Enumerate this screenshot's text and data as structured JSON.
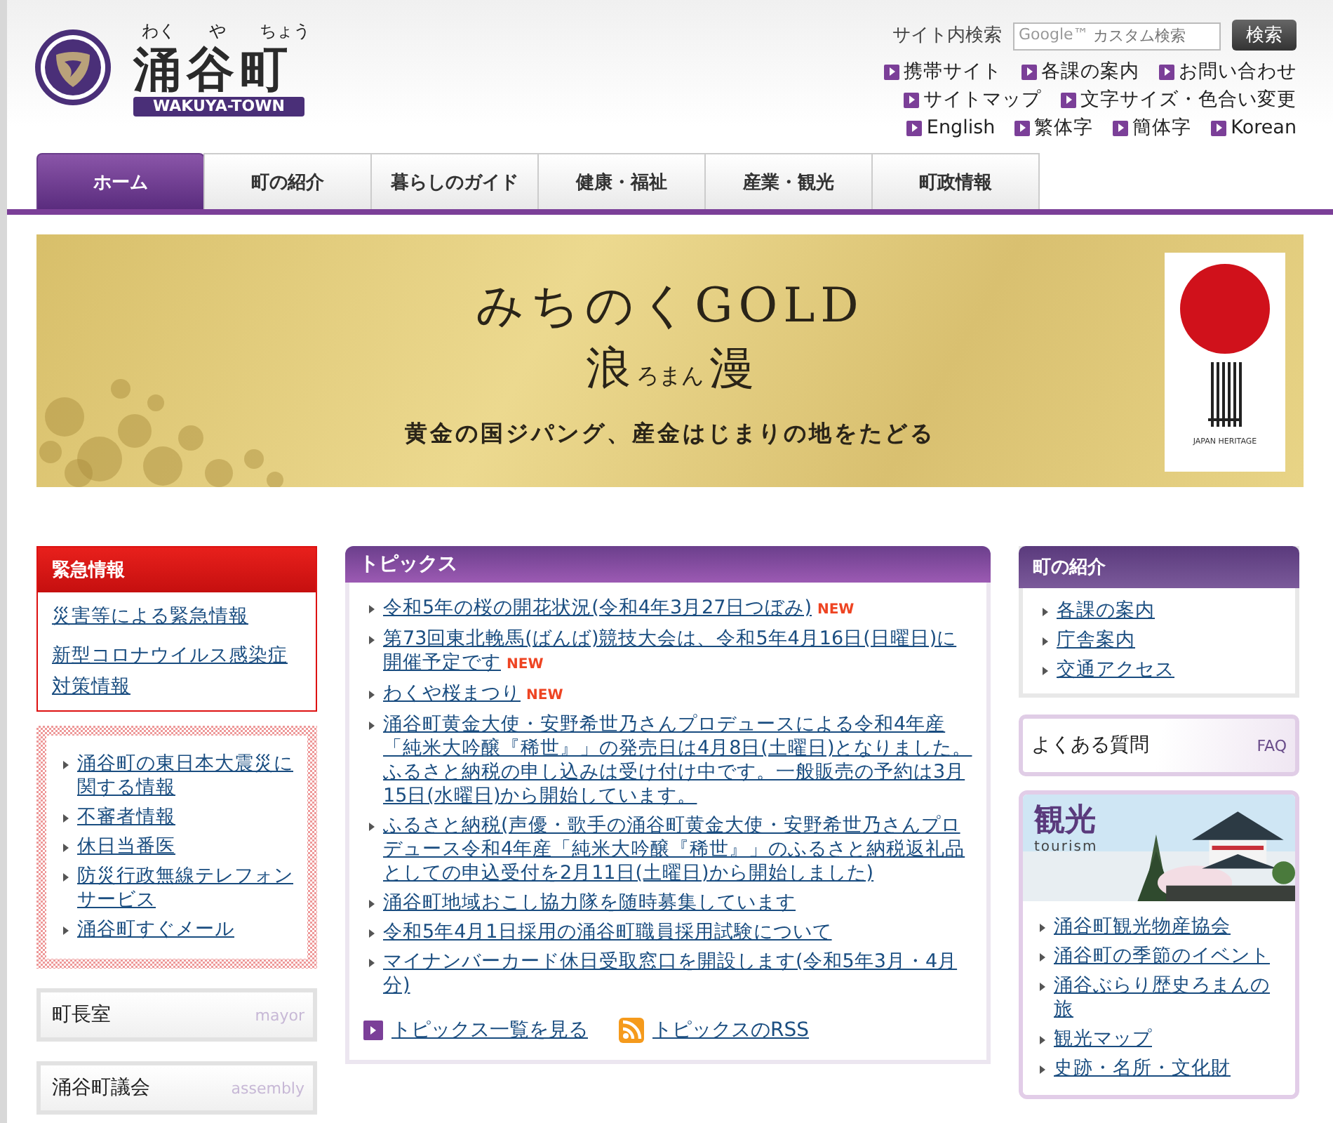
{
  "header": {
    "ruby": [
      "わく",
      "や",
      "ちょう"
    ],
    "title": "涌谷町",
    "subtitle": "WAKUYA-TOWN",
    "search": {
      "label": "サイト内検索",
      "brand": "Google™",
      "placeholder": "カスタム検索",
      "button": "検索"
    },
    "utility_links": [
      [
        "携帯サイト",
        "各課の案内",
        "お問い合わせ"
      ],
      [
        "サイトマップ",
        "文字サイズ・色合い変更"
      ],
      [
        "English",
        "繁体字",
        "簡体字",
        "Korean"
      ]
    ]
  },
  "tabs": [
    {
      "label": "ホーム",
      "selected": true
    },
    {
      "label": "町の紹介",
      "selected": false
    },
    {
      "label": "暮らしのガイド",
      "selected": false
    },
    {
      "label": "健康・福祉",
      "selected": false
    },
    {
      "label": "産業・観光",
      "selected": false
    },
    {
      "label": "町政情報",
      "selected": false
    }
  ],
  "banner": {
    "headline": "みちのくGOLD",
    "title_left": "浪",
    "title_ruby": "ろまん",
    "title_right": "漫",
    "tagline": "黄金の国ジパング、産金はじまりの地をたどる",
    "badge_caption": "JAPAN HERITAGE"
  },
  "emergency": {
    "title": "緊急情報",
    "links": [
      "災害等による緊急情報",
      "新型コロナウイルス感染症対策情報"
    ]
  },
  "disaster_links": [
    "涌谷町の東日本大震災に関する情報",
    "不審者情報",
    "休日当番医",
    "防災行政無線テレフォンサービス",
    "涌谷町すぐメール"
  ],
  "side_banners": [
    {
      "label": "町長室",
      "sub": "mayor"
    },
    {
      "label": "涌谷町議会",
      "sub": "assembly"
    }
  ],
  "topics": {
    "title": "トピックス",
    "items": [
      {
        "text": "令和5年の桜の開花状況(令和4年3月27日つぼみ)",
        "badge": "NEW"
      },
      {
        "text": "第73回東北輓馬(ばんば)競技大会は、令和5年4月16日(日曜日)に開催予定です",
        "badge": "NEW"
      },
      {
        "text": "わくや桜まつり",
        "badge": "NEW"
      },
      {
        "text": "涌谷町黄金大使・安野希世乃さんプロデュースによる令和4年産「純米大吟醸『稀世』」の発売日は4月8日(土曜日)となりました。ふるさと納税の申し込みは受け付け中です。一般販売の予約は3月15日(水曜日)から開始しています。"
      },
      {
        "text": "ふるさと納税(声優・歌手の涌谷町黄金大使・安野希世乃さんプロデュース令和4年産「純米大吟醸『稀世』」のふるさと納税返礼品としての申込受付を2月11日(土曜日)から開始しました)"
      },
      {
        "text": "涌谷町地域おこし協力隊を随時募集しています"
      },
      {
        "text": "令和5年4月1日採用の涌谷町職員採用試験について"
      },
      {
        "text": "マイナンバーカード休日受取窓口を開設します(令和5年3月・4月分)"
      }
    ],
    "list_link": "トピックス一覧を見る",
    "rss_link": "トピックスのRSS"
  },
  "intro": {
    "title": "町の紹介",
    "links": [
      "各課の案内",
      "庁舎案内",
      "交通アクセス"
    ]
  },
  "faq": {
    "label": "よくある質問",
    "sub": "FAQ"
  },
  "tourism": {
    "title": "観光",
    "subtitle": "tourism",
    "links": [
      "涌谷町観光物産協会",
      "涌谷町の季節のイベント",
      "涌谷ぶらり歴史ろまんの旅",
      "観光マップ",
      "史跡・名所・文化財"
    ]
  }
}
